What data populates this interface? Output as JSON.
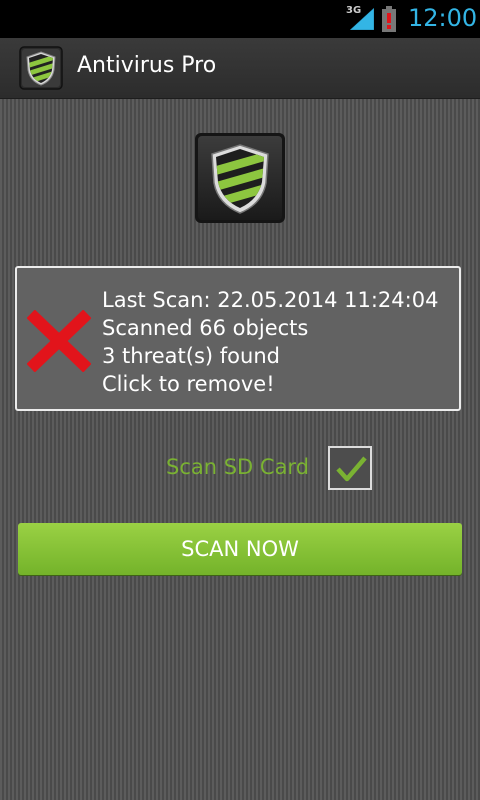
{
  "status_bar": {
    "network_type": "3G",
    "time": "12:00",
    "icons": [
      "signal-icon",
      "battery-alert-icon"
    ],
    "clock_color": "#33b5e5"
  },
  "action_bar": {
    "icon": "shield-icon",
    "title": "Antivirus Pro"
  },
  "main": {
    "logo_icon": "shield-icon",
    "status": {
      "icon": "red-x-icon",
      "last_scan": "Last Scan: 22.05.2014 11:24:04",
      "scanned": "Scanned 66 objects",
      "threats": "3 threat(s) found",
      "action": "Click to remove!"
    },
    "scan_sd": {
      "label": "Scan SD Card",
      "checked": true
    },
    "scan_button_label": "SCAN NOW"
  },
  "colors": {
    "accent_green": "#7ab232",
    "button_green": "#8bc53f",
    "alert_red": "#e2141b"
  }
}
